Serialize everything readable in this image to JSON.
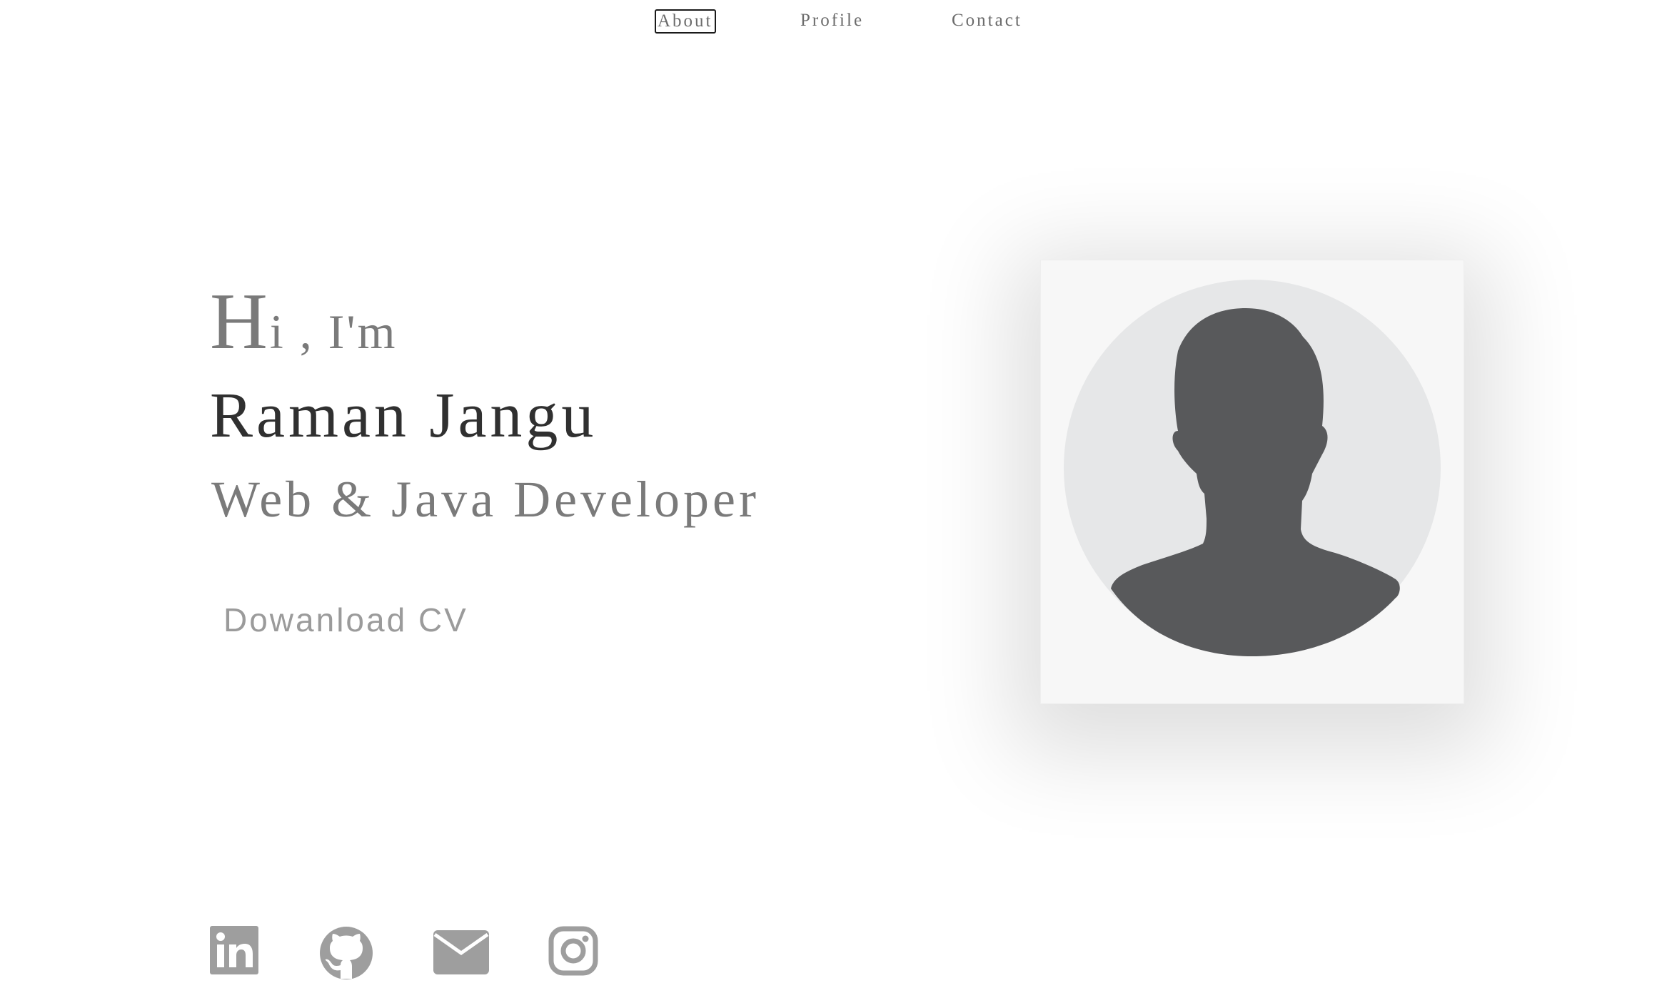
{
  "nav": {
    "items": [
      {
        "label": "About",
        "active": true
      },
      {
        "label": "Profile",
        "active": false
      },
      {
        "label": "Contact",
        "active": false
      }
    ]
  },
  "hero": {
    "greeting_first_letter": "H",
    "greeting_rest": "i , I'm",
    "name": "Raman Jangu",
    "role": "Web & Java Developer",
    "cv_button_label": "Dowanload CV"
  },
  "profile_image": {
    "icon": "default-avatar-silhouette"
  },
  "social": [
    {
      "icon": "linkedin-icon"
    },
    {
      "icon": "github-icon"
    },
    {
      "icon": "email-icon"
    },
    {
      "icon": "instagram-icon"
    }
  ],
  "colors": {
    "text_dark": "#303030",
    "text_gray": "#7a7a7a",
    "icon_gray": "#9e9e9e",
    "card_bg": "#f7f7f7",
    "avatar_bg": "#e6e7e8",
    "silhouette": "#58595b"
  }
}
